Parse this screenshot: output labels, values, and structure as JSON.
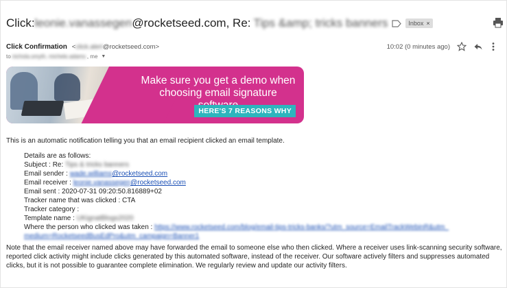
{
  "subject": {
    "prefix": "Click:",
    "recipient_blurred": "leonie.vanassegen",
    "domain": "@rocketseed.com, Re:",
    "title_blurred": "Tips &amp; tricks banners",
    "label_chip": "Inbox",
    "label_close": "×"
  },
  "sender": {
    "name": "Click Confirmation",
    "email_blurred": "click.alert",
    "email_domain": "@rocketseed.com>",
    "to_prefix": "to",
    "to_blurred": "nichola.smyth, michele.adams",
    "to_suffix": ", me",
    "time": "10:02 (0 minutes ago)"
  },
  "banner": {
    "headline_line1": "Make sure you get a demo when",
    "headline_line2": "choosing email signature software",
    "cta": "HERE'S 7 REASONS WHY"
  },
  "body": {
    "intro": "This is an automatic notification telling you that an email recipient clicked an email template.",
    "details_heading": "Details are as follows:",
    "subject_label": "Subject : Re: ",
    "subject_value_blurred": "Tips & tricks banners",
    "sender_label": "Email sender : ",
    "sender_value_blurred": "wade.williams",
    "sender_value_domain": "@rocketseed.com",
    "receiver_label": "Email receiver : ",
    "receiver_value_blurred": "leonie.vanassegen",
    "receiver_value_domain": "@rocketseed.com",
    "sent_line": "Email sent : 2020-07-31 09:20:50.816889+02",
    "tracker_name_line": "Tracker name that was clicked : CTA",
    "tracker_category_line": "Tracker category :",
    "template_label": "Template name : ",
    "template_value_blurred": "UKignatBlogs2020",
    "clicked_label": "Where the person who clicked was taken : ",
    "clicked_url_blurred_1": "https://www.rocketseed.com/blog/email-tips-tricks-banks/?utm_source=EmailTrackWebinR&utm_",
    "clicked_url_blurred_2": "medium=RocketseedBusEdPro&utm_campaign=Banner1",
    "note": "Note that the email receiver named above may have forwarded the email to someone else who then clicked. Where a receiver uses link-scanning security software, reported click activity might include clicks generated by this automated software, instead of the receiver. Our software actively filters and suppresses automated clicks, but it is not possible to guarantee complete elimination. We regularly review and update our activity filters."
  },
  "icons": {
    "label_icon": "label-arrow-icon",
    "print": "print-icon",
    "star": "star-icon",
    "reply": "reply-icon",
    "more": "more-vertical-icon"
  },
  "colors": {
    "banner_pink": "#d3318d",
    "cta_teal": "#2db5bd",
    "link_blue": "#1a4fb5"
  }
}
